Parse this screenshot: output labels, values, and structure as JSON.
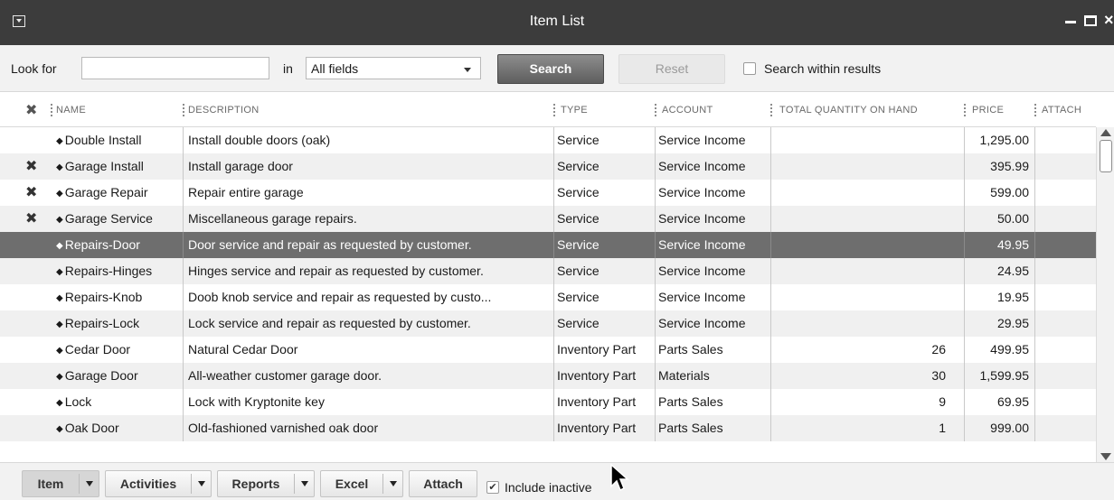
{
  "window": {
    "title": "Item List"
  },
  "search": {
    "look_for_label": "Look for",
    "look_for_value": "",
    "in_label": "in",
    "fields_value": "All fields",
    "search_button": "Search",
    "reset_button": "Reset",
    "search_within_label": "Search within results",
    "search_within_checked": false
  },
  "table": {
    "headers": {
      "name": "NAME",
      "description": "DESCRIPTION",
      "type": "TYPE",
      "account": "ACCOUNT",
      "qty": "TOTAL QUANTITY ON HAND",
      "price": "PRICE",
      "attach": "ATTACH"
    },
    "rows": [
      {
        "inactive": false,
        "name": "Double Install",
        "description": "Install double doors (oak)",
        "type": "Service",
        "account": "Service Income",
        "qty": "",
        "price": "1,295.00"
      },
      {
        "inactive": true,
        "name": "Garage Install",
        "description": "Install garage door",
        "type": "Service",
        "account": "Service Income",
        "qty": "",
        "price": "395.99"
      },
      {
        "inactive": true,
        "name": "Garage Repair",
        "description": "Repair entire garage",
        "type": "Service",
        "account": "Service Income",
        "qty": "",
        "price": "599.00"
      },
      {
        "inactive": true,
        "name": "Garage Service",
        "description": "Miscellaneous garage repairs.",
        "type": "Service",
        "account": "Service Income",
        "qty": "",
        "price": "50.00"
      },
      {
        "inactive": false,
        "selected": true,
        "name": "Repairs-Door",
        "description": "Door service and repair as requested by customer.",
        "type": "Service",
        "account": "Service Income",
        "qty": "",
        "price": "49.95"
      },
      {
        "inactive": false,
        "name": "Repairs-Hinges",
        "description": "Hinges service and repair as requested by customer.",
        "type": "Service",
        "account": "Service Income",
        "qty": "",
        "price": "24.95"
      },
      {
        "inactive": false,
        "name": "Repairs-Knob",
        "description": "Doob knob service and repair as requested by custo...",
        "type": "Service",
        "account": "Service Income",
        "qty": "",
        "price": "19.95"
      },
      {
        "inactive": false,
        "name": "Repairs-Lock",
        "description": "Lock service and repair as requested by customer.",
        "type": "Service",
        "account": "Service Income",
        "qty": "",
        "price": "29.95"
      },
      {
        "inactive": false,
        "name": "Cedar Door",
        "description": "Natural Cedar Door",
        "type": "Inventory Part",
        "account": "Parts Sales",
        "qty": "26",
        "price": "499.95"
      },
      {
        "inactive": false,
        "name": "Garage Door",
        "description": "All-weather customer garage door.",
        "type": "Inventory Part",
        "account": "Materials",
        "qty": "30",
        "price": "1,599.95"
      },
      {
        "inactive": false,
        "name": "Lock",
        "description": "Lock with Kryptonite key",
        "type": "Inventory Part",
        "account": "Parts Sales",
        "qty": "9",
        "price": "69.95"
      },
      {
        "inactive": false,
        "name": "Oak Door",
        "description": "Old-fashioned varnished oak door",
        "type": "Inventory Part",
        "account": "Parts Sales",
        "qty": "1",
        "price": "999.00"
      }
    ]
  },
  "toolbar": {
    "item": "Item",
    "activities": "Activities",
    "reports": "Reports",
    "excel": "Excel",
    "attach": "Attach",
    "include_inactive_label": "Include inactive",
    "include_inactive_checked": true
  }
}
